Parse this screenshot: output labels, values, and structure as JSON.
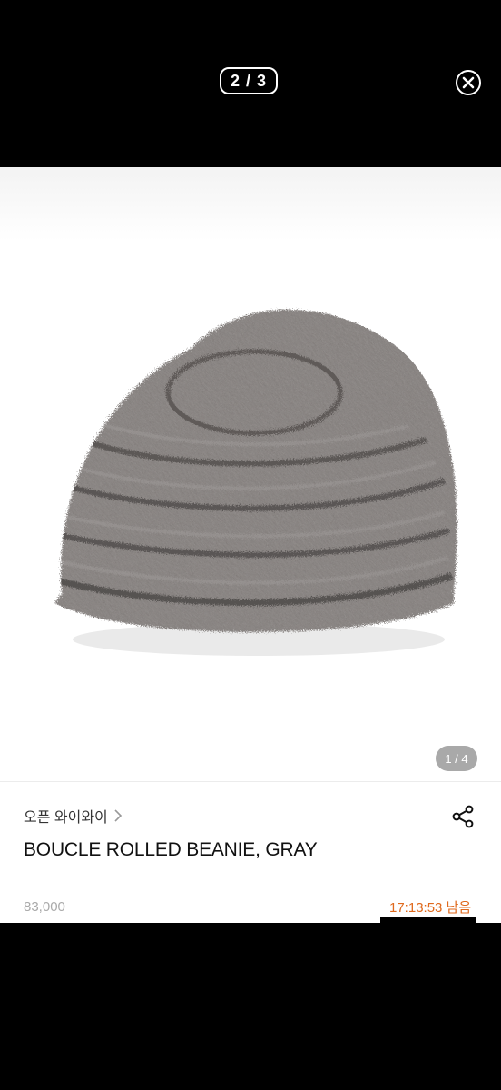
{
  "viewer": {
    "counter": "2 / 3"
  },
  "product": {
    "image_pager": "1 / 4",
    "shop_name": "오픈 와이와이",
    "title": "BOUCLE ROLLED BEANIE, GRAY",
    "original_price": "83,000",
    "timer": "17:13:53 남음"
  },
  "icons": {
    "close": "close-circle-icon",
    "share": "share-icon",
    "chevron": "chevron-right-icon"
  }
}
